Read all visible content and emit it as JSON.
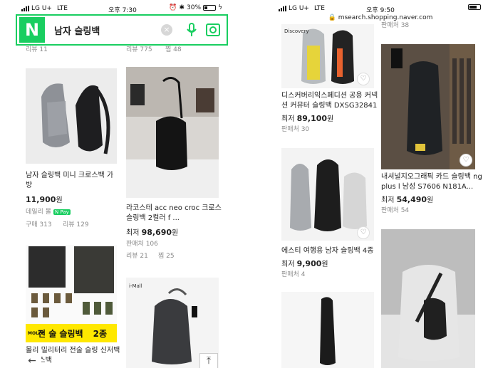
{
  "left": {
    "status": {
      "carrier": "LG U+",
      "network": "LTE",
      "time": "오후 7:30",
      "battery": "30%"
    },
    "search": {
      "query": "남자 슬링백"
    },
    "top_partial": {
      "left_meta": "리뷰 11",
      "right_meta_1": "리뷰 775",
      "right_meta_2": "찜 48"
    },
    "products": [
      {
        "title": "남자 슬링백 미니 크로스백 가방",
        "price": "11,900",
        "won": "원",
        "seller": "데일리 몰",
        "npay": "N Pay",
        "meta1": "구매 313",
        "meta2": "리뷰 129"
      },
      {
        "title": "라코스테 acc neo croc 크로스 슬링백 2컬러 f ...",
        "price_prefix": "최저",
        "price": "98,690",
        "won": "원",
        "meta1": "판매처 106",
        "meta2": "리뷰 21",
        "meta3": "찜 25"
      },
      {
        "title": "몰리 밀리터리 전술 슬링 신저백 크로스백",
        "banner_small": "MOLLE",
        "banner_text1": "전 술 슬링백",
        "banner_text2": "2종"
      },
      {
        "brand": "i-Mall"
      }
    ]
  },
  "right": {
    "status": {
      "carrier": "LG U+",
      "network": "LTE",
      "time": "오후 9:50"
    },
    "url": "msearch.shopping.naver.com",
    "top_partial": {
      "meta": "판매처 38"
    },
    "products": [
      {
        "title": "디스커버리익스페디션 공용 커넥션 커뮤터 슬링백 DXSG32841",
        "price_prefix": "최저",
        "price": "89,100",
        "won": "원",
        "meta1": "판매처 30",
        "brand": "Discovery"
      },
      {
        "title": "내셔널지오그래픽 카드 슬링백 ng plus l 남성 S7606 N181A...",
        "price_prefix": "최저",
        "price": "54,490",
        "won": "원",
        "meta1": "판매처 54"
      },
      {
        "title": "에스티 여행용 남자 슬링백 4종",
        "price_prefix": "최저",
        "price": "9,900",
        "won": "원",
        "meta1": "판매처 4"
      },
      {
        "title": ""
      }
    ]
  },
  "colors": {
    "naver_green": "#19ce60",
    "banner_yellow": "#ffe800"
  },
  "icons": [
    "naver-logo",
    "clear-icon",
    "microphone-icon",
    "camera-search-icon",
    "heart-icon",
    "back-arrow-icon",
    "scroll-top-icon",
    "lock-icon"
  ]
}
